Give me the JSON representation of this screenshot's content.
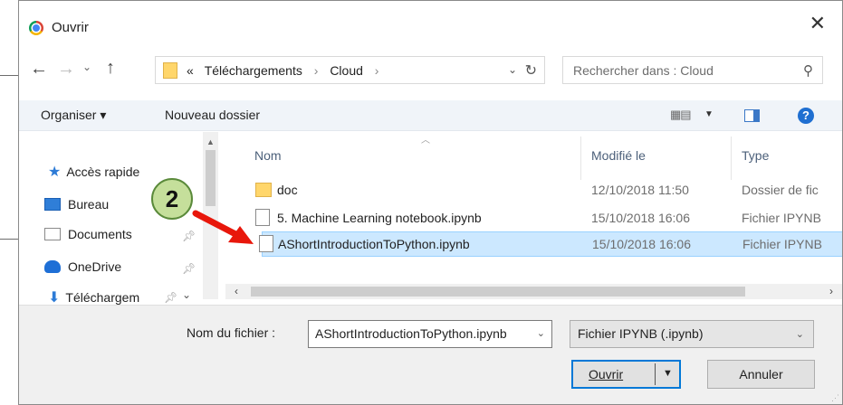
{
  "window": {
    "title": "Ouvrir",
    "close_glyph": "✕"
  },
  "address": {
    "overflow": "«",
    "crumbs": [
      "Téléchargements",
      "Cloud"
    ],
    "separator": "›"
  },
  "search": {
    "placeholder": "Rechercher dans : Cloud"
  },
  "toolbar": {
    "organize_label": "Organiser ▾",
    "new_folder_label": "Nouveau dossier"
  },
  "sidebar": {
    "items": [
      {
        "label": "Accès rapide",
        "icon": "star-icon"
      },
      {
        "label": "Bureau",
        "icon": "desktop-icon"
      },
      {
        "label": "Documents",
        "icon": "documents-icon"
      },
      {
        "label": "OneDrive",
        "icon": "onedrive-icon"
      },
      {
        "label": "Téléchargem",
        "icon": "download-icon"
      }
    ]
  },
  "filelist": {
    "columns": [
      "Nom",
      "Modifié le",
      "Type"
    ],
    "rows": [
      {
        "name": "doc",
        "modified": "12/10/2018 11:50",
        "type": "Dossier de fic",
        "icon": "folder-icon",
        "selected": false
      },
      {
        "name": "5. Machine Learning notebook.ipynb",
        "modified": "15/10/2018 16:06",
        "type": "Fichier IPYNB",
        "icon": "file-icon",
        "selected": false
      },
      {
        "name": "AShortIntroductionToPython.ipynb",
        "modified": "15/10/2018 16:06",
        "type": "Fichier IPYNB",
        "icon": "file-icon",
        "selected": true
      }
    ]
  },
  "footer": {
    "filename_label": "Nom du fichier :",
    "filename_value": "AShortIntroductionToPython.ipynb",
    "filter_value": "Fichier IPYNB (.ipynb)",
    "open_label": "Ouvrir",
    "cancel_label": "Annuler"
  },
  "annotation": {
    "badge_number": "2",
    "badge_color": "#c5df9b",
    "arrow_color": "#e8170b"
  }
}
